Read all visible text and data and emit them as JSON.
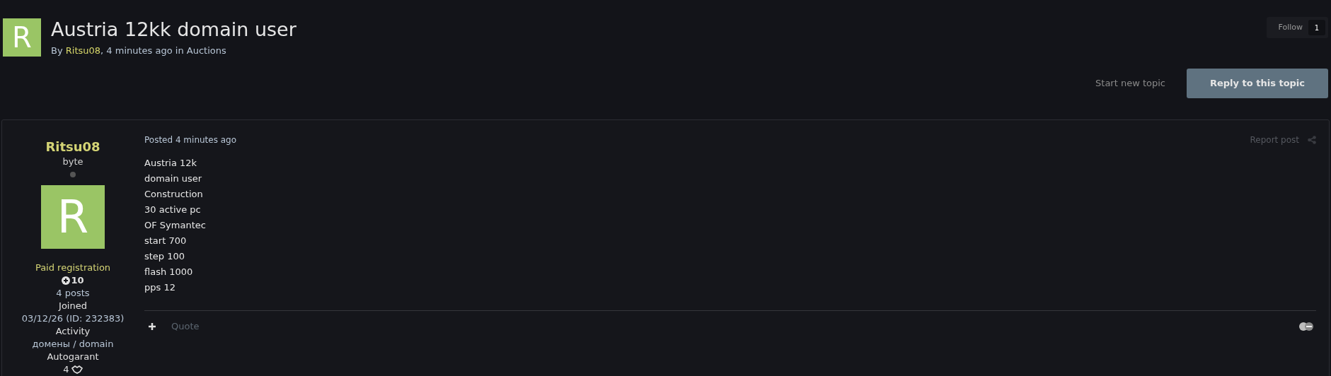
{
  "topic": {
    "avatar_letter": "R",
    "title": "Austria 12kk domain user",
    "byline_prefix": "By",
    "author": "Ritsu08",
    "byline_middle": ", 4 minutes ago in",
    "forum": "Auctions"
  },
  "follow": {
    "label": "Follow",
    "count": "1"
  },
  "actions": {
    "start_topic": "Start new topic",
    "reply": "Reply to this topic"
  },
  "post": {
    "author": {
      "name": "Ritsu08",
      "rank": "byte",
      "online": false,
      "avatar_letter": "R",
      "group": "Paid registration",
      "reputation": "10",
      "posts": "4 posts",
      "fields": [
        {
          "label": "Joined",
          "value": "03/12/26 (ID: 232383)"
        },
        {
          "label": "Activity",
          "value": "домены / domain"
        },
        {
          "label": "Autogarant",
          "value": "4"
        }
      ]
    },
    "posted": "Posted 4 minutes ago",
    "report": "Report post",
    "lines": [
      "Austria 12k",
      "domain user",
      "Construction",
      "30 active pc",
      "OF Symantec",
      "start 700",
      "step 100",
      "flash 1000",
      "pps 12"
    ],
    "quote": "Quote"
  }
}
